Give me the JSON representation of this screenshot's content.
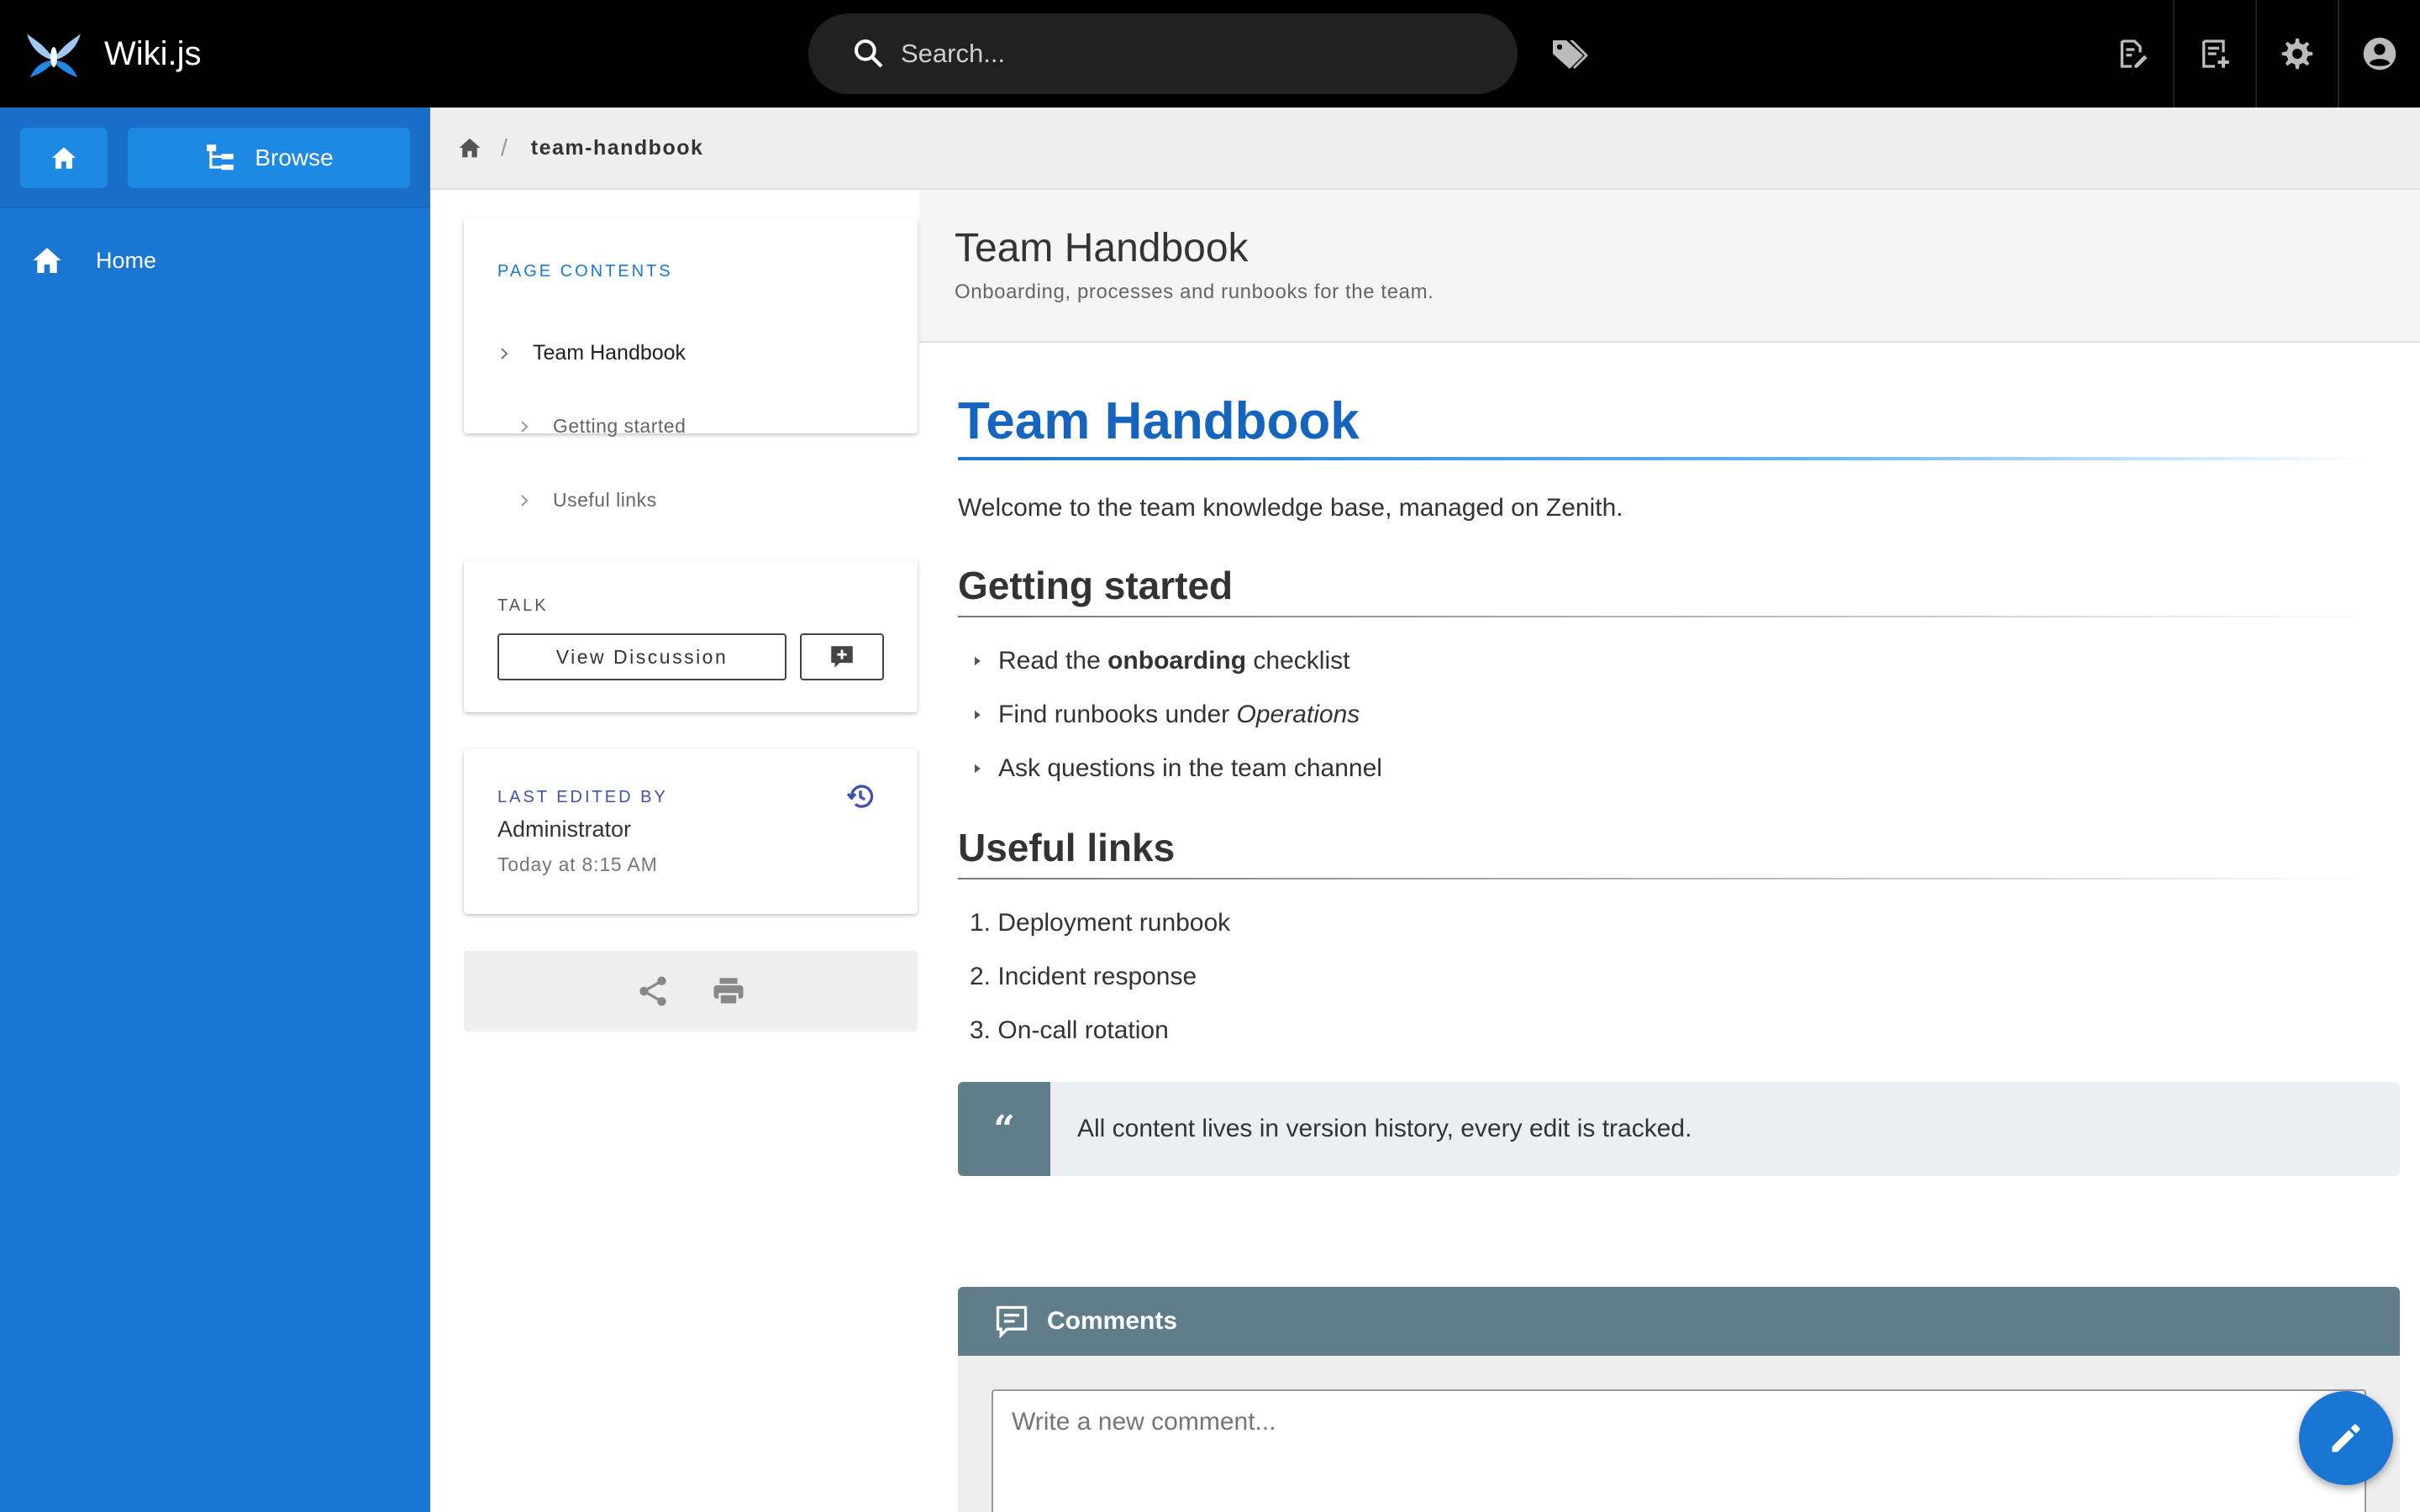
{
  "app": {
    "name": "Wiki.js"
  },
  "search": {
    "placeholder": "Search..."
  },
  "topbar": {
    "actions": [
      {
        "icon": "new-page-icon"
      },
      {
        "icon": "page-actions-icon"
      },
      {
        "icon": "gear-icon"
      },
      {
        "icon": "account-icon"
      }
    ]
  },
  "sidebar": {
    "browse_label": "Browse",
    "items": [
      {
        "label": "Home",
        "icon": "home-icon"
      }
    ]
  },
  "breadcrumb": {
    "items": [
      "team-handbook"
    ]
  },
  "page": {
    "title": "Team Handbook",
    "description": "Onboarding, processes and runbooks for the team."
  },
  "toc": {
    "label": "PAGE CONTENTS",
    "items": [
      "Team Handbook",
      "Getting started",
      "Useful links"
    ]
  },
  "talk": {
    "label": "TALK",
    "view_discussion": "View Discussion"
  },
  "last_edit": {
    "label": "LAST EDITED BY",
    "name": "Administrator",
    "date": "Today at 8:15 AM"
  },
  "content": {
    "h1": "Team Handbook",
    "intro": "Welcome to the team knowledge base, managed on Zenith.",
    "section1": {
      "title": "Getting started",
      "items": [
        {
          "pre": "Read the ",
          "bold": "onboarding",
          "post": " checklist"
        },
        {
          "pre": "Find runbooks under ",
          "italic": "Operations"
        },
        {
          "pre": "Ask questions in the team channel"
        }
      ]
    },
    "section2": {
      "title": "Useful links",
      "items": [
        "1. Deployment runbook",
        "2. Incident response",
        "3. On-call rotation"
      ]
    },
    "quote": "All content lives in version history, every edit is tracked."
  },
  "comments": {
    "title": "Comments",
    "placeholder": "Write a new comment..."
  },
  "colors": {
    "topbar": "#000000",
    "sidebar": "#1976d2",
    "accent": "#1565c0",
    "quote_bar": "#607d8b"
  }
}
